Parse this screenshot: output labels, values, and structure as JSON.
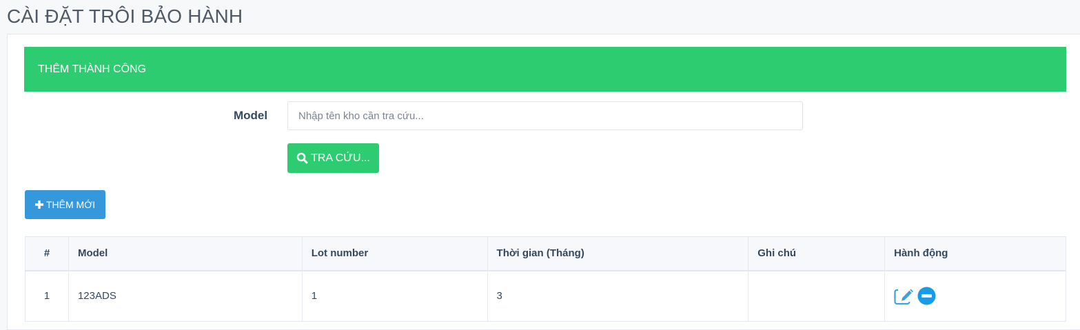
{
  "page": {
    "title": "CÀI ĐẶT TRÔI BẢO HÀNH"
  },
  "alert": {
    "text": "THÊM THÀNH CÔNG"
  },
  "search": {
    "label": "Model",
    "placeholder": "Nhập tên kho cần tra cứu...",
    "value": "",
    "button_label": "TRA CỨU...",
    "button_icon": "search-icon"
  },
  "add_button": {
    "label": "THÊM MỚI",
    "icon": "plus-icon"
  },
  "table": {
    "headers": [
      "#",
      "Model",
      "Lot number",
      "Thời gian (Tháng)",
      "Ghi chú",
      "Hành động"
    ],
    "rows": [
      {
        "index": "1",
        "model": "123ADS",
        "lot_number": "1",
        "duration_months": "3",
        "note": "",
        "actions": [
          "edit-icon",
          "remove-icon"
        ]
      }
    ]
  },
  "colors": {
    "success": "#2ecc71",
    "primary": "#3498db",
    "text": "#34495e"
  }
}
